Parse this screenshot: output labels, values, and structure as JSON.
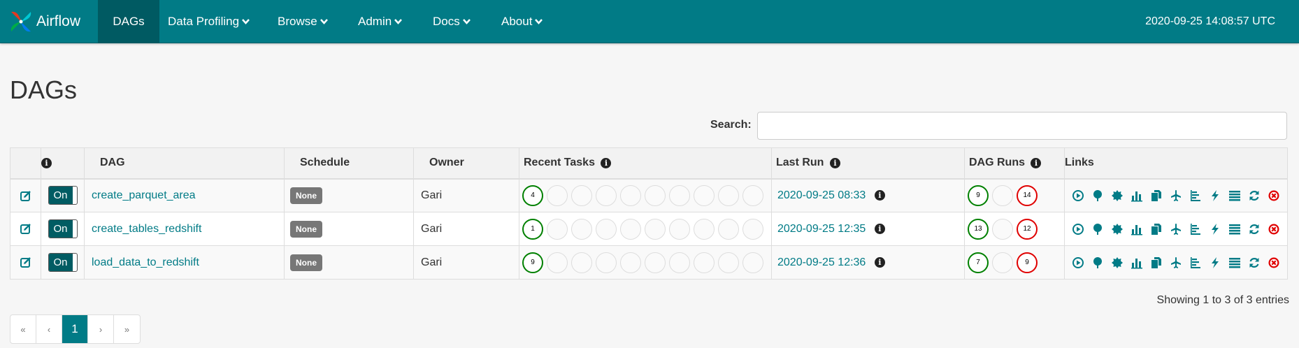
{
  "brand": {
    "name": "Airflow"
  },
  "nav": {
    "items": [
      {
        "label": "DAGs"
      },
      {
        "label": "Data Profiling"
      },
      {
        "label": "Browse"
      },
      {
        "label": "Admin"
      },
      {
        "label": "Docs"
      },
      {
        "label": "About"
      }
    ],
    "time": "2020-09-25 14:08:57 UTC"
  },
  "page": {
    "title": "DAGs"
  },
  "search": {
    "label": "Search:",
    "value": ""
  },
  "table": {
    "headers": {
      "info": "i",
      "dag": "DAG",
      "schedule": "Schedule",
      "owner": "Owner",
      "recent_tasks": "Recent Tasks",
      "last_run": "Last Run",
      "dag_runs": "DAG Runs",
      "links": "Links"
    },
    "rows": [
      {
        "toggle": "On",
        "dag": "create_parquet_area",
        "schedule": "None",
        "owner": "Gari",
        "recent_tasks": {
          "success": "4"
        },
        "last_run": "2020-09-25 08:33",
        "dag_runs": {
          "success": "9",
          "failed": "14"
        }
      },
      {
        "toggle": "On",
        "dag": "create_tables_redshift",
        "schedule": "None",
        "owner": "Gari",
        "recent_tasks": {
          "success": "1"
        },
        "last_run": "2020-09-25 12:35",
        "dag_runs": {
          "success": "13",
          "failed": "12"
        }
      },
      {
        "toggle": "On",
        "dag": "load_data_to_redshift",
        "schedule": "None",
        "owner": "Gari",
        "recent_tasks": {
          "success": "9"
        },
        "last_run": "2020-09-25 12:36",
        "dag_runs": {
          "success": "7",
          "failed": "9"
        }
      }
    ],
    "link_icons": [
      "play-circle-icon",
      "tree-icon",
      "graph-icon",
      "bar-chart-icon",
      "duration-icon",
      "gantt-plane-icon",
      "landing-times-icon",
      "flash-icon",
      "list-icon",
      "refresh-icon",
      "delete-icon"
    ]
  },
  "footer": {
    "showing": "Showing 1 to 3 of 3 entries",
    "pagination": {
      "first": "«",
      "prev": "‹",
      "current": "1",
      "next": "›",
      "last": "»"
    }
  },
  "colors": {
    "navbar": "#017b86",
    "accent": "#017b86",
    "success": "#008000",
    "failed": "#e00000"
  }
}
